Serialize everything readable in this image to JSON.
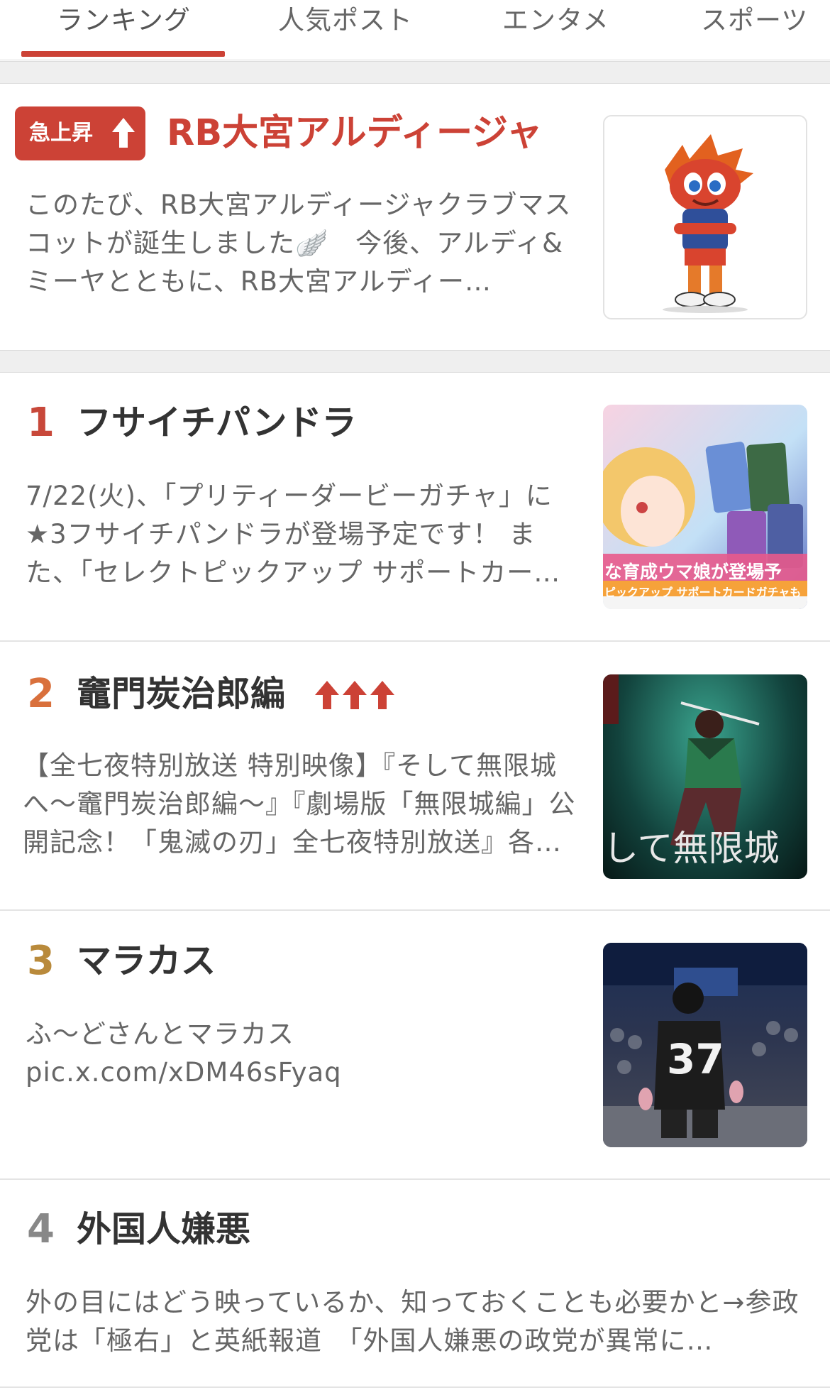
{
  "tabs": [
    {
      "label": "ランキング",
      "active": true
    },
    {
      "label": "人気ポスト",
      "active": false
    },
    {
      "label": "エンタメ",
      "active": false
    },
    {
      "label": "スポーツ",
      "active": false
    }
  ],
  "featured": {
    "badge": "急上昇",
    "title": "RB大宮アルディージャ",
    "description": "このたび、RB大宮アルディージャクラブマスコットが誕生しました🪽　今後、アルディ&ミーヤとともに、RB大宮アルディー…"
  },
  "ranking": [
    {
      "rank": "1",
      "title": "フサイチパンドラ",
      "description": "7/22(火)、「プリティーダービーガチャ」に★3フサイチパンドラが登場予定です！ また、「セレクトピックアップ サポートカー…",
      "rank_color": "#c8483a"
    },
    {
      "rank": "2",
      "title": "竈門炭治郎編",
      "description": "【全七夜特別放送 特別映像】『そして無限城へ〜竈門炭治郎編〜』『劇場版「無限城編」公開記念！「鬼滅の刃」全七夜特別放送』各…",
      "rank_color": "#d9703c"
    },
    {
      "rank": "3",
      "title": "マラカス",
      "description": "ふ〜どさんとマラカス pic.x.com/xDM46sFyaq",
      "rank_color": "#b98a3b"
    },
    {
      "rank": "4",
      "title": "外国人嫌悪",
      "description": "外の目にはどう映っているか、知っておくことも必要かと→参政党は「極右」と英紙報道　「外国人嫌悪の政党が異常に…",
      "rank_color": "#888888"
    }
  ],
  "thumb_texts": {
    "uma_banner": "な育成ウマ娘が登場予",
    "uma_sub": "ピックアップ サポートカードガチャも",
    "kimetsu_caption": "して無限城",
    "jersey_number": "37"
  },
  "colors": {
    "accent": "#cc4236"
  }
}
